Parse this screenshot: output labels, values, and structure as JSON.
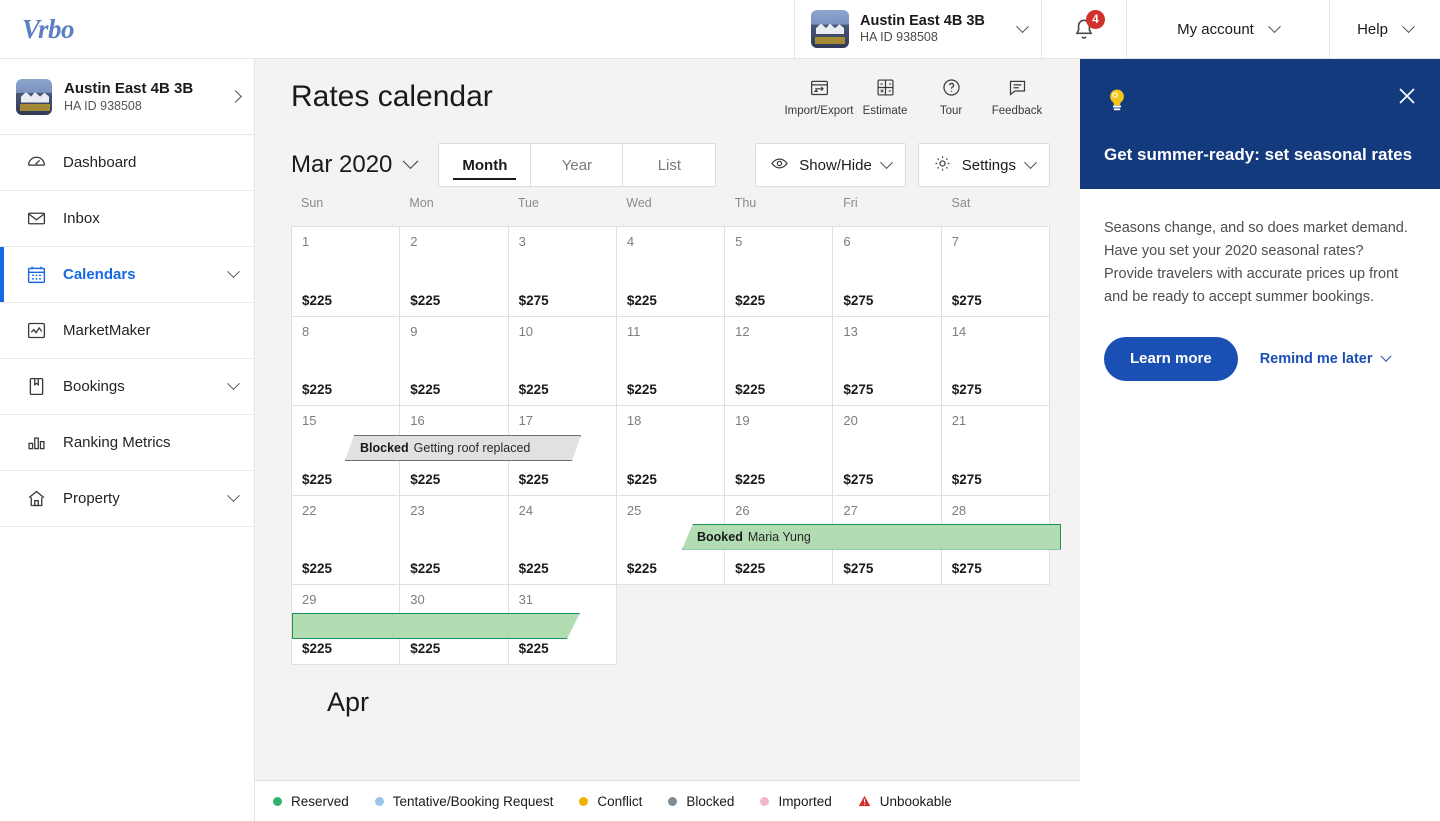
{
  "brand": {
    "logo_text": "Vrbo",
    "logo_color": "#5b7fc4",
    "accent": "#1668e3",
    "promo_bg": "#133a7c"
  },
  "topbar": {
    "property": {
      "name": "Austin East 4B 3B",
      "id": "HA ID 938508"
    },
    "notifications": {
      "count": "4",
      "icon": "bell-icon",
      "badge_color": "#d0312d"
    },
    "account_label": "My account",
    "help_label": "Help"
  },
  "sidebar": {
    "property": {
      "name": "Austin East 4B 3B",
      "id": "HA ID 938508"
    },
    "items": [
      {
        "label": "Dashboard",
        "icon": "gauge-icon",
        "active": false,
        "expandable": false
      },
      {
        "label": "Inbox",
        "icon": "envelope-icon",
        "active": false,
        "expandable": false
      },
      {
        "label": "Calendars",
        "icon": "calendar-icon",
        "active": true,
        "expandable": true
      },
      {
        "label": "MarketMaker",
        "icon": "chart-line-icon",
        "active": false,
        "expandable": false
      },
      {
        "label": "Bookings",
        "icon": "book-icon",
        "active": false,
        "expandable": true
      },
      {
        "label": "Ranking Metrics",
        "icon": "bar-chart-icon",
        "active": false,
        "expandable": false
      },
      {
        "label": "Property",
        "icon": "home-icon",
        "active": false,
        "expandable": true
      }
    ]
  },
  "main": {
    "title": "Rates calendar",
    "tools": [
      {
        "label": "Import/Export",
        "icon": "import-export-icon"
      },
      {
        "label": "Estimate",
        "icon": "calculator-icon"
      },
      {
        "label": "Tour",
        "icon": "question-circle-icon"
      },
      {
        "label": "Feedback",
        "icon": "comment-icon"
      }
    ],
    "month_selector": "Mar 2020",
    "view_tabs": [
      {
        "label": "Month",
        "selected": true
      },
      {
        "label": "Year",
        "selected": false
      },
      {
        "label": "List",
        "selected": false
      }
    ],
    "show_hide_label": "Show/Hide",
    "settings_label": "Settings",
    "next_month_label": "Apr"
  },
  "calendar": {
    "day_headers": [
      "Sun",
      "Mon",
      "Tue",
      "Wed",
      "Thu",
      "Fri",
      "Sat"
    ],
    "weeks": [
      {
        "days": [
          {
            "num": "1",
            "price": "$225"
          },
          {
            "num": "2",
            "price": "$225"
          },
          {
            "num": "3",
            "price": "$275"
          },
          {
            "num": "4",
            "price": "$225"
          },
          {
            "num": "5",
            "price": "$225"
          },
          {
            "num": "6",
            "price": "$275"
          },
          {
            "num": "7",
            "price": "$275"
          }
        ]
      },
      {
        "days": [
          {
            "num": "8",
            "price": "$225"
          },
          {
            "num": "9",
            "price": "$225"
          },
          {
            "num": "10",
            "price": "$225"
          },
          {
            "num": "11",
            "price": "$225"
          },
          {
            "num": "12",
            "price": "$225"
          },
          {
            "num": "13",
            "price": "$275"
          },
          {
            "num": "14",
            "price": "$275"
          }
        ]
      },
      {
        "days": [
          {
            "num": "15",
            "price": "$225"
          },
          {
            "num": "16",
            "price": "$225"
          },
          {
            "num": "17",
            "price": "$225"
          },
          {
            "num": "18",
            "price": "$225"
          },
          {
            "num": "19",
            "price": "$225"
          },
          {
            "num": "20",
            "price": "$275"
          },
          {
            "num": "21",
            "price": "$275"
          }
        ]
      },
      {
        "days": [
          {
            "num": "22",
            "price": "$225"
          },
          {
            "num": "23",
            "price": "$225"
          },
          {
            "num": "24",
            "price": "$225"
          },
          {
            "num": "25",
            "price": "$225"
          },
          {
            "num": "26",
            "price": "$225"
          },
          {
            "num": "27",
            "price": "$275"
          },
          {
            "num": "28",
            "price": "$275"
          }
        ]
      },
      {
        "days": [
          {
            "num": "29",
            "price": "$225"
          },
          {
            "num": "30",
            "price": "$225"
          },
          {
            "num": "31",
            "price": "$225"
          }
        ]
      }
    ],
    "events": [
      {
        "kind": "blocked",
        "title": "Blocked",
        "subtitle": "Getting roof replaced"
      },
      {
        "kind": "booked",
        "title": "Booked",
        "subtitle": "Maria Yung"
      },
      {
        "kind": "booked_continuation",
        "title": "",
        "subtitle": ""
      }
    ]
  },
  "legend": [
    {
      "label": "Reserved",
      "color": "#2db36a",
      "icon": "dot-icon"
    },
    {
      "label": "Tentative/Booking Request",
      "color": "#9cc4e8",
      "icon": "dot-icon"
    },
    {
      "label": "Conflict",
      "color": "#f0b000",
      "icon": "dot-icon"
    },
    {
      "label": "Blocked",
      "color": "#7e8c96",
      "icon": "dot-icon"
    },
    {
      "label": "Imported",
      "color": "#f0b6cf",
      "icon": "dot-icon"
    },
    {
      "label": "Unbookable",
      "color": "#d0312d",
      "icon": "warning-triangle-icon"
    }
  ],
  "promo": {
    "icon": "lightbulb-icon",
    "title": "Get summer-ready: set seasonal rates",
    "body": "Seasons change, and so does market demand. Have you set your 2020 seasonal rates? Provide travelers with accurate prices up front and be ready to accept summer bookings.",
    "primary_label": "Learn more",
    "secondary_label": "Remind me later",
    "close_icon": "close-icon"
  }
}
